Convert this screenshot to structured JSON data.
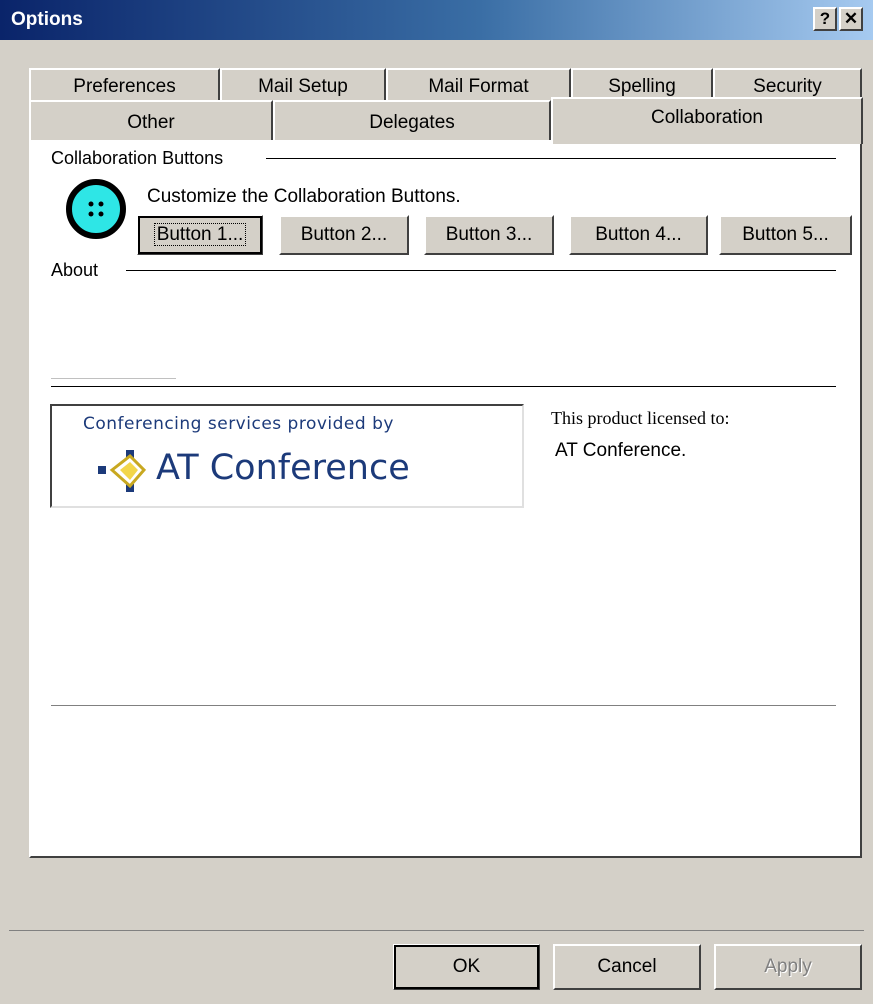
{
  "window": {
    "title": "Options",
    "help_glyph": "?",
    "close_glyph": "✕"
  },
  "tabs_back": [
    "Preferences",
    "Mail Setup",
    "Mail Format",
    "Spelling",
    "Security"
  ],
  "tabs_front": [
    "Other",
    "Delegates",
    "Collaboration"
  ],
  "active_tab": "Collaboration",
  "collab": {
    "section_label": "Collaboration Buttons",
    "customize_text": "Customize the Collaboration Buttons.",
    "icon": "collaboration-button-icon",
    "buttons": [
      "Button 1...",
      "Button 2...",
      "Button 3...",
      "Button 4...",
      "Button 5..."
    ]
  },
  "about": {
    "section_label": "About",
    "logo_caption": "Conferencing services provided by",
    "logo_brand": "AT Conference",
    "licensed_label": "This product licensed to:",
    "licensed_value": "AT Conference."
  },
  "footer": {
    "ok": "OK",
    "cancel": "Cancel",
    "apply": "Apply"
  },
  "colors": {
    "title_gradient_start": "#0a246a",
    "title_gradient_end": "#a6caf0",
    "icon_fill": "#2ee6e6",
    "brand_blue": "#1c3a7a"
  }
}
